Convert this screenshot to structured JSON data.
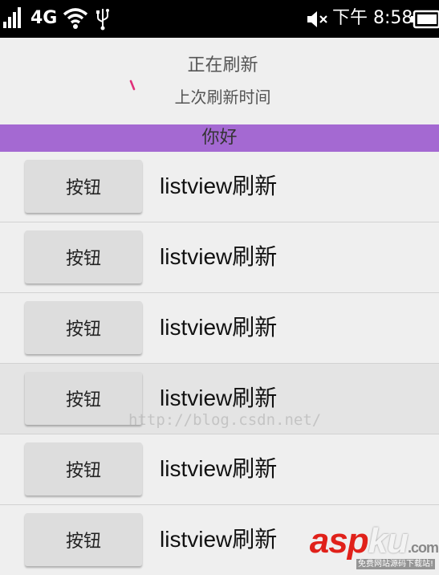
{
  "status_bar": {
    "network": "4G",
    "time": "下午 8:58",
    "icons": [
      "signal-icon",
      "wifi-icon",
      "usb-icon",
      "mute-icon",
      "battery-icon"
    ]
  },
  "refresh_header": {
    "status": "正在刷新",
    "last_refresh_label": "上次刷新时间",
    "spinner_color": "#e0307a"
  },
  "banner": {
    "text": "你好",
    "background": "#a469d2"
  },
  "list": {
    "rows": [
      {
        "button": "按钮",
        "text": "listview刷新"
      },
      {
        "button": "按钮",
        "text": "listview刷新"
      },
      {
        "button": "按钮",
        "text": "listview刷新"
      },
      {
        "button": "按钮",
        "text": "listview刷新"
      },
      {
        "button": "按钮",
        "text": "listview刷新"
      },
      {
        "button": "按钮",
        "text": "listview刷新"
      }
    ]
  },
  "watermark": {
    "url": "http://blog.csdn.net/",
    "logo_part1": "asp",
    "logo_part2": "ku",
    "logo_part3": ".com",
    "logo_sub": "免费网站源码下载站!"
  }
}
